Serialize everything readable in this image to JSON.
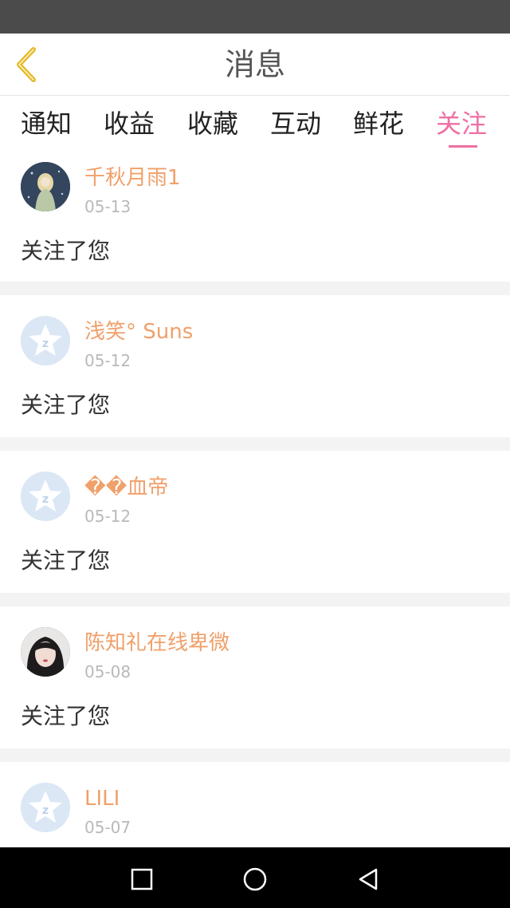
{
  "header": {
    "title": "消息"
  },
  "tabs": [
    {
      "label": "通知"
    },
    {
      "label": "收益"
    },
    {
      "label": "收藏"
    },
    {
      "label": "互动"
    },
    {
      "label": "鲜花"
    },
    {
      "label": "关注",
      "active": true
    }
  ],
  "items": [
    {
      "name": "千秋月雨1",
      "date": "05-13",
      "message": "关注了您",
      "avatar": "photo-girl-illustration"
    },
    {
      "name": "浅笑° Suns",
      "date": "05-12",
      "message": "关注了您",
      "avatar": "default-star"
    },
    {
      "name": "��血帝",
      "date": "05-12",
      "message": "关注了您",
      "avatar": "default-star"
    },
    {
      "name": "陈知礼在线卑微",
      "date": "05-08",
      "message": "关注了您",
      "avatar": "photo-girl"
    },
    {
      "name": "LILI",
      "date": "05-07",
      "message": "",
      "avatar": "default-star"
    }
  ],
  "colors": {
    "accent_pink": "#ee6fa4",
    "name_orange": "#f0a06a",
    "back_arrow": "#e5b92a"
  },
  "system_nav": {
    "icons": [
      "recent-apps-icon",
      "home-icon",
      "back-icon"
    ]
  }
}
